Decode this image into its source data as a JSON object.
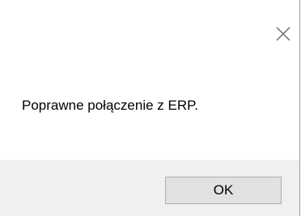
{
  "dialog": {
    "message": "Poprawne połączenie z ERP.",
    "ok_label": "OK",
    "close_icon": "close-icon"
  }
}
